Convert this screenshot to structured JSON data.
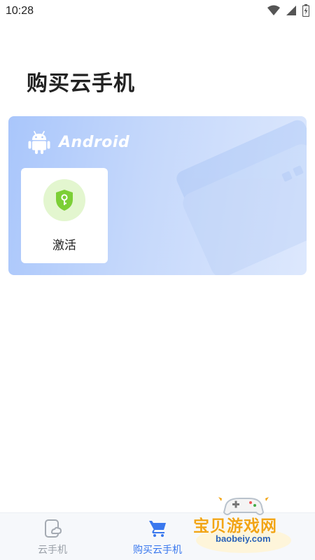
{
  "status_bar": {
    "time": "10:28",
    "icons": [
      "wifi-icon",
      "signal-icon",
      "battery-icon"
    ]
  },
  "page": {
    "title": "购买云手机"
  },
  "card": {
    "platform": "Android",
    "tiles": [
      {
        "label": "激活",
        "icon": "shield-key-icon"
      }
    ]
  },
  "tab_bar": {
    "tabs": [
      {
        "label": "云手机",
        "icon": "phone-cloud-icon",
        "active": false
      },
      {
        "label": "购买云手机",
        "icon": "cart-icon",
        "active": true
      },
      {
        "label": "",
        "icon": "",
        "active": false
      }
    ]
  },
  "watermark": {
    "title": "宝贝游戏网",
    "url": "baobeiy.com"
  },
  "colors": {
    "accent": "#3a78ee",
    "inactive_tab": "#9aa0a8",
    "card_gradient_start": "#a9c6fb",
    "card_gradient_end": "#dde8fd",
    "activate_icon": "#7ccf36",
    "watermark_title": "#f2a516"
  }
}
